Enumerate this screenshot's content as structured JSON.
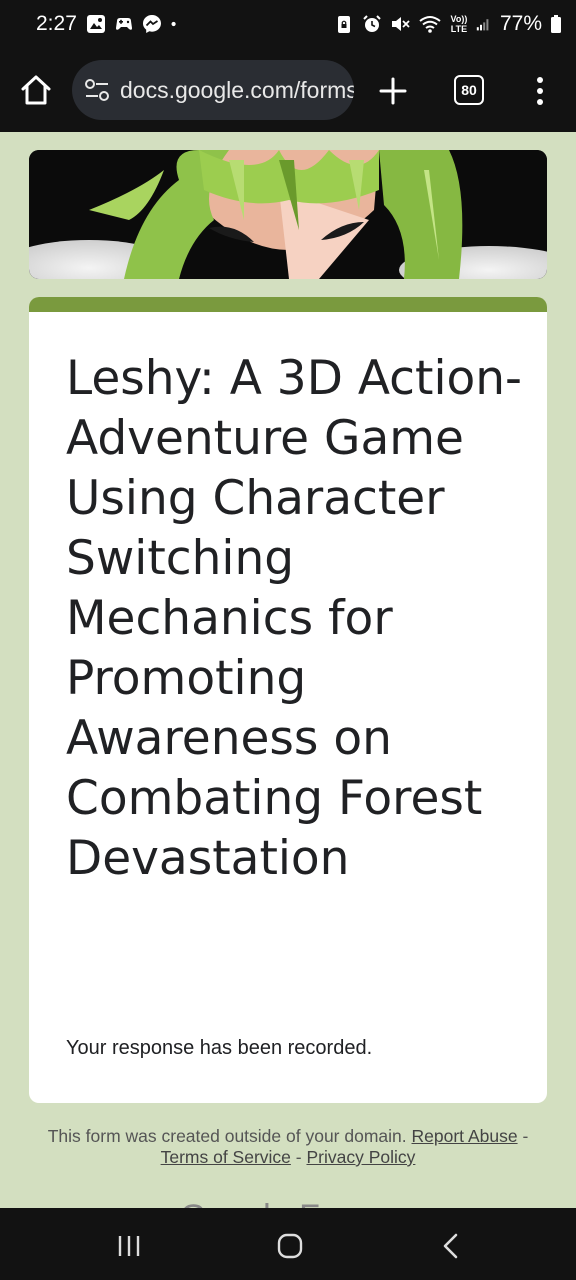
{
  "status_bar": {
    "time": "2:27",
    "battery": "77%",
    "icons_left": [
      "gallery-icon",
      "game-icon",
      "messenger-icon",
      "dot-icon"
    ],
    "icons_right": [
      "lock-icon",
      "alarm-icon",
      "mute-icon",
      "wifi-icon",
      "volte-icon",
      "signal-icon",
      "battery-icon"
    ],
    "volte_label": "Vo)) LTE"
  },
  "browser": {
    "url": "docs.google.com/forms",
    "tab_count": "80"
  },
  "form": {
    "title": "Leshy: A 3D Action-Adventure Game Using Character Switching Mechanics for Promoting Awareness on Combating Forest Devastation",
    "confirmation": "Your response has been recorded."
  },
  "footer": {
    "text": "This form was created outside of your domain.",
    "report_abuse": "Report Abuse",
    "separator": "-",
    "terms": "Terms of Service",
    "privacy": "Privacy Policy",
    "logo_text": "Google Forms"
  },
  "colors": {
    "page_background": "#d3dfc0",
    "accent": "#7a9a3e",
    "bars": "#121212"
  }
}
